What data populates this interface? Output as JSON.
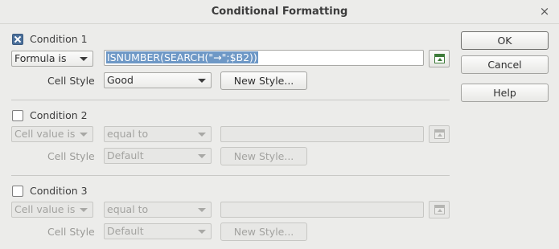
{
  "window": {
    "title": "Conditional Formatting",
    "close_glyph": "×"
  },
  "conditions": [
    {
      "label": "Condition 1",
      "checked": true,
      "type": "Formula is",
      "formula": "ISNUMBER(SEARCH(\"→\";$B2))",
      "cell_style_label": "Cell Style",
      "cell_style": "Good",
      "new_style_label": "New Style..."
    },
    {
      "label": "Condition 2",
      "checked": false,
      "type": "Cell value is",
      "operator": "equal to",
      "value": "",
      "cell_style_label": "Cell Style",
      "cell_style": "Default",
      "new_style_label": "New Style..."
    },
    {
      "label": "Condition 3",
      "checked": false,
      "type": "Cell value is",
      "operator": "equal to",
      "value": "",
      "cell_style_label": "Cell Style",
      "cell_style": "Default",
      "new_style_label": "New Style..."
    }
  ],
  "buttons": {
    "ok": "OK",
    "cancel": "Cancel",
    "help": "Help"
  },
  "icons": {
    "shrink": "shrink-icon",
    "close": "close-icon"
  }
}
